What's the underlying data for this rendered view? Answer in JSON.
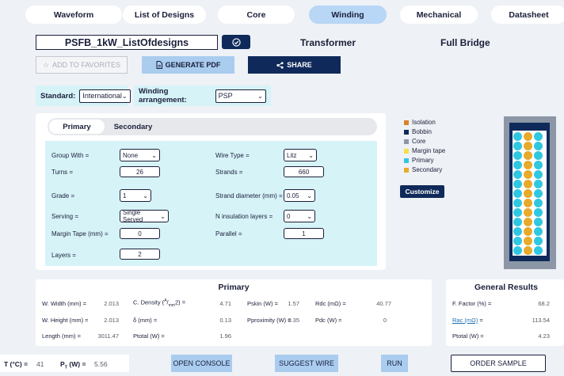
{
  "tabs": [
    {
      "label": "Waveform"
    },
    {
      "label": "List of Designs"
    },
    {
      "label": "Core"
    },
    {
      "label": "Winding"
    },
    {
      "label": "Mechanical"
    },
    {
      "label": "Datasheet"
    }
  ],
  "design_name": "PSFB_1kW_ListOfdesigns",
  "component_type": "Transformer",
  "topology": "Full Bridge",
  "actions": {
    "favorites": "ADD TO FAVORITES",
    "pdf": "GENERATE PDF",
    "share": "SHARE"
  },
  "standard": {
    "label": "Standard:",
    "value": "International"
  },
  "winding_arrangement": {
    "label": "Winding arrangement:",
    "value": "PSP"
  },
  "subtabs": {
    "primary": "Primary",
    "secondary": "Secondary"
  },
  "form": {
    "group_with": {
      "label": "Group With =",
      "value": "None"
    },
    "turns": {
      "label": "Turns =",
      "value": "26"
    },
    "grade": {
      "label": "Grade =",
      "value": "1"
    },
    "serving": {
      "label": "Serving =",
      "value": "Single Served"
    },
    "margin_tape": {
      "label": "Margin Tape (mm) =",
      "value": "0"
    },
    "layers": {
      "label": "Layers =",
      "value": "2"
    },
    "wire_type": {
      "label": "Wire Type =",
      "value": "Litz"
    },
    "strands": {
      "label": "Strands =",
      "value": "660"
    },
    "strand_diameter": {
      "label": "Strand diameter (mm) =",
      "value": "0.05"
    },
    "n_insulation": {
      "label": "N insulation layers =",
      "value": "0"
    },
    "parallel": {
      "label": "Parallel =",
      "value": "1"
    }
  },
  "legend": [
    {
      "label": "Isolation",
      "color": "#d9822b"
    },
    {
      "label": "Bobbin",
      "color": "#0f2a5a"
    },
    {
      "label": "Core",
      "color": "#8c96a6"
    },
    {
      "label": "Margin tape",
      "color": "#f5e04a"
    },
    {
      "label": "Primary",
      "color": "#2fc8e0"
    },
    {
      "label": "Secondary",
      "color": "#e8aa2a"
    }
  ],
  "customize_label": "Customize",
  "primary_results": {
    "title": "Primary",
    "w_width": {
      "label": "W. Width (mm) =",
      "value": "2.013"
    },
    "w_height": {
      "label": "W. Height (mm) =",
      "value": "2.013"
    },
    "length": {
      "label": "Length (mm) =",
      "value": "3011.47"
    },
    "c_density": {
      "label_pre": "C. Density (",
      "label_sup": "A",
      "label_mid": "/",
      "label_sub": "mm",
      "label_post": "2) =",
      "value": "4.71"
    },
    "delta": {
      "label": "δ (mm) =",
      "value": "0.13"
    },
    "ptotal": {
      "label": "Ptotal (W) =",
      "value": "1.96"
    },
    "pskin": {
      "label": "Pskin (W) =",
      "value": "1.57"
    },
    "pproximity": {
      "label": "Pproximity (W) =",
      "value": "0.35"
    },
    "rdc": {
      "label": "Rdc (mΩ) =",
      "value": "40.77"
    },
    "pdc": {
      "label": "Pdc (W) =",
      "value": "0"
    }
  },
  "general_results": {
    "title": "General Results",
    "f_factor": {
      "label": "F. Factor (%) =",
      "value": "68.2"
    },
    "rac": {
      "label": "Rac (mΩ)",
      "label_eq": " =",
      "value": "113.54"
    },
    "ptotal": {
      "label": "Ptotal (W) =",
      "value": "4.23"
    }
  },
  "bottom": {
    "t_label": "T (°C) =",
    "t_value": "41",
    "pt_label_main": "P",
    "pt_label_sub": "T",
    "pt_label_tail": " (W) =",
    "pt_value": "5.56",
    "open_console": "OPEN CONSOLE",
    "suggest_wire": "SUGGEST WIRE",
    "run": "RUN",
    "order_sample": "ORDER SAMPLE"
  }
}
